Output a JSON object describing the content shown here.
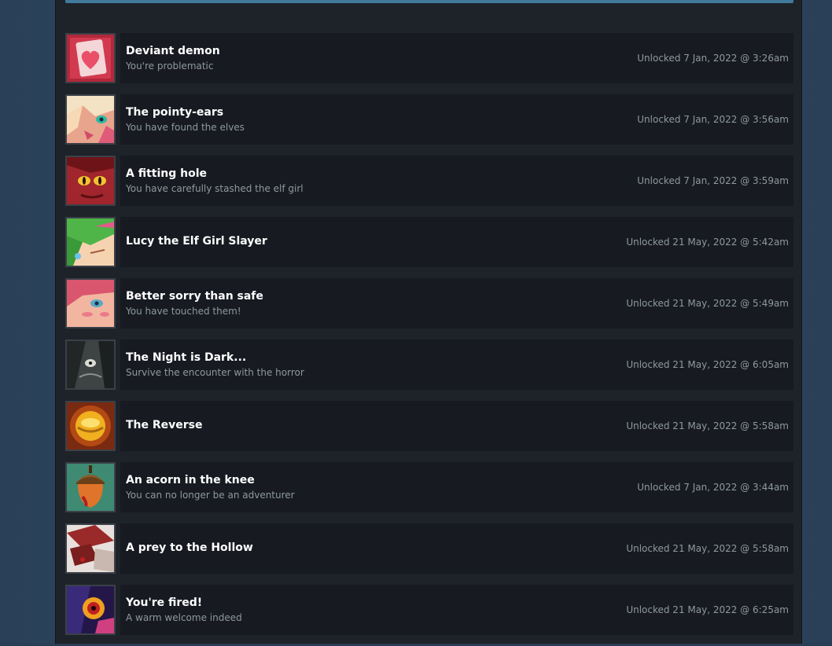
{
  "achievements": [
    {
      "title": "Deviant demon",
      "description": "You're problematic",
      "unlocked": "Unlocked 7 Jan, 2022 @ 3:26am",
      "icon": "heart-card-icon"
    },
    {
      "title": "The pointy-ears",
      "description": "You have found the elves",
      "unlocked": "Unlocked 7 Jan, 2022 @ 3:56am",
      "icon": "elf-face-icon"
    },
    {
      "title": "A fitting hole",
      "description": "You have carefully stashed the elf girl",
      "unlocked": "Unlocked 7 Jan, 2022 @ 3:59am",
      "icon": "red-demon-face-icon"
    },
    {
      "title": "Lucy the Elf Girl Slayer",
      "description": "",
      "unlocked": "Unlocked 21 May, 2022 @ 5:42am",
      "icon": "green-hair-girl-icon"
    },
    {
      "title": "Better sorry than safe",
      "description": "You have touched them!",
      "unlocked": "Unlocked 21 May, 2022 @ 5:49am",
      "icon": "blushing-girl-icon"
    },
    {
      "title": "The Night is Dark...",
      "description": "Survive the encounter with the horror",
      "unlocked": "Unlocked 21 May, 2022 @ 6:05am",
      "icon": "dark-horror-face-icon"
    },
    {
      "title": "The Reverse",
      "description": "",
      "unlocked": "Unlocked 21 May, 2022 @ 5:58am",
      "icon": "golden-orb-icon"
    },
    {
      "title": "An acorn in the knee",
      "description": "You can no longer be an adventurer",
      "unlocked": "Unlocked 7 Jan, 2022 @ 3:44am",
      "icon": "acorn-icon"
    },
    {
      "title": "A prey to the Hollow",
      "description": "",
      "unlocked": "Unlocked 21 May, 2022 @ 5:58am",
      "icon": "claw-icon"
    },
    {
      "title": "You're fired!",
      "description": "A warm welcome indeed",
      "unlocked": "Unlocked 21 May, 2022 @ 6:25am",
      "icon": "fire-face-icon"
    }
  ]
}
